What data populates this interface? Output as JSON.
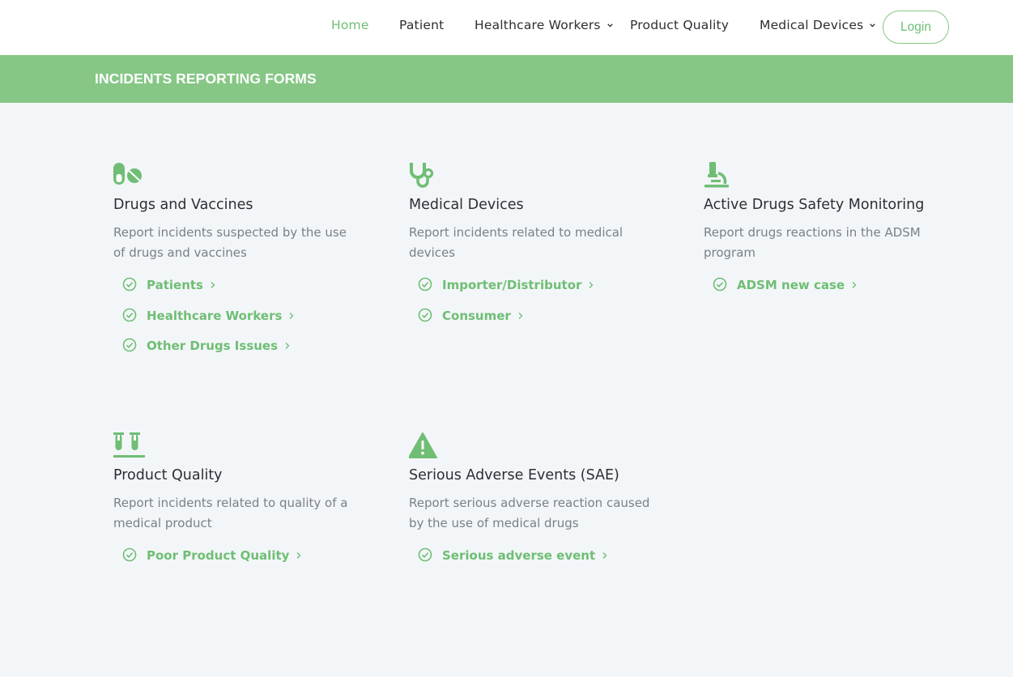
{
  "nav": {
    "items": [
      {
        "label": "Home",
        "active": true
      },
      {
        "label": "Patient"
      },
      {
        "label": "Healthcare Workers",
        "dropdown": true
      },
      {
        "label": "Product Quality"
      },
      {
        "label": "Medical Devices",
        "dropdown": true
      }
    ],
    "login_label": "Login"
  },
  "banner": {
    "title": "INCIDENTS REPORTING FORMS"
  },
  "colors": {
    "accent": "#6fbe74",
    "banner": "#86c786",
    "background": "#f3f6f8"
  },
  "cards": [
    {
      "icon": "pills-icon",
      "title": "Drugs and Vaccines",
      "desc": "Report incidents suspected by the use of drugs and vaccines",
      "links": [
        "Patients",
        "Healthcare Workers",
        "Other Drugs Issues"
      ]
    },
    {
      "icon": "stethoscope-icon",
      "title": "Medical Devices",
      "desc": "Report incidents related to medical devices",
      "links": [
        "Importer/Distributor",
        "Consumer"
      ]
    },
    {
      "icon": "microscope-icon",
      "title": "Active Drugs Safety Monitoring",
      "desc": "Report drugs reactions in the ADSM program",
      "links": [
        "ADSM new case"
      ]
    },
    {
      "icon": "test-tubes-icon",
      "title": "Product Quality",
      "desc": "Report incidents related to quality of a medical product",
      "links": [
        "Poor Product Quality"
      ]
    },
    {
      "icon": "warning-icon",
      "title": "Serious Adverse Events (SAE)",
      "desc": "Report serious adverse reaction caused by the use of medical drugs",
      "links": [
        "Serious adverse event"
      ]
    }
  ]
}
